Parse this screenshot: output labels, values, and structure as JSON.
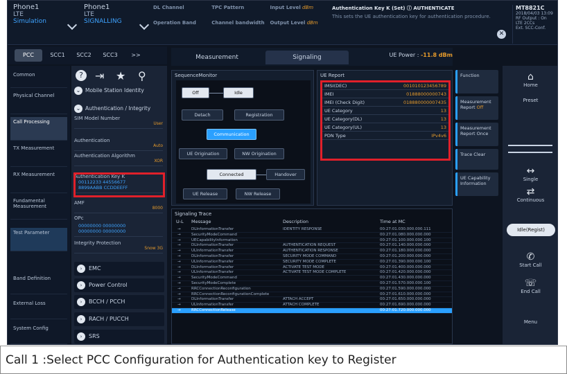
{
  "top": {
    "cell1": {
      "name": "Phone1",
      "line2": "LTE",
      "line3": "Simulation"
    },
    "cell2": {
      "name": "Phone1",
      "line2": "LTE",
      "line3": "SIGNALLING"
    },
    "stats": [
      {
        "label": "DL Channel",
        "value": ""
      },
      {
        "label": "TPC Pattern",
        "value": ""
      },
      {
        "label": "Input Level",
        "value": "dBm"
      },
      {
        "label": "Operation Band",
        "value": ""
      },
      {
        "label": "Channel bandwidth",
        "value": ""
      },
      {
        "label": "Output Level",
        "value": "dBm"
      }
    ],
    "auth_title": "Authentication Key K (Set) ⓘ AUTHENTICATE",
    "auth_desc": "This sets the UE authentication key for authentication procedure.",
    "sysinfo": {
      "logo": "MT8821C",
      "l1": "2018/04/03 13:09",
      "l2": "RF Output : On",
      "l3": "LTE 2CCs",
      "l4": "Ext. SCC-Conf."
    }
  },
  "cc_tabs": [
    "PCC",
    "SCC1",
    "SCC2",
    "SCC3",
    ">>"
  ],
  "left_nav": [
    "Common",
    "Physical Channel",
    "Call Processing",
    "TX Measurement",
    "RX Measurement",
    "Fundamental Measurement",
    "Test Parameter",
    "Band Definition",
    "External Loss",
    "System Config"
  ],
  "feature_list": {
    "sec_mobile": "Mobile Station Identity",
    "sec_auth": "Authentication / Integrity",
    "sim_model_label": "SIM Model Number",
    "sim_model_value": "User",
    "authentication_label": "Authentication",
    "authentication_value": "Auto",
    "auth_alg_label": "Authentication Algorithm",
    "auth_alg_value": "XOR",
    "auth_key_label": "Authentication Key K",
    "auth_key_line1": "00112233 44556677",
    "auth_key_line2": "8899AABB CCDDEEFF",
    "amf_label": "AMF",
    "amf_value": "8000",
    "opc_label": "OPc",
    "opc_line1": "00000000 00000000",
    "opc_line2": "00000000 00000000",
    "integrity_label": "Integrity Protection",
    "integrity_value": "Snow 3G",
    "sections": [
      "EMC",
      "Power Control",
      "BCCH / PCCH",
      "RACH / PUCCH",
      "SRS"
    ]
  },
  "tabs": {
    "measurement": "Measurement",
    "signaling": "Signaling"
  },
  "ue_power": {
    "label": "UE Power :",
    "value": "-11.8 dBm"
  },
  "sequence_monitor": {
    "title": "SequenceMonitor",
    "nodes": [
      "Off",
      "Idle",
      "Detach",
      "Registration",
      "Communication",
      "UE Origination",
      "NW Origination",
      "Connected",
      "Handover",
      "UE Release",
      "NW Release"
    ]
  },
  "ue_report": {
    "title": "UE Report",
    "rows": [
      {
        "key": "IMSI(DEC)",
        "value": "001010123456789"
      },
      {
        "key": "IMEI",
        "value": "01888000000743"
      },
      {
        "key": "IMEI (Check Digit)",
        "value": "018880000007435"
      },
      {
        "key": "UE Category",
        "value": "13"
      },
      {
        "key": "UE Category(DL)",
        "value": "13"
      },
      {
        "key": "UE Category(UL)",
        "value": "13"
      },
      {
        "key": "PDN Type",
        "value": "IPv4v6"
      }
    ]
  },
  "right_buttons": [
    {
      "label": "Function",
      "sub": ""
    },
    {
      "label": "Measurement Report",
      "sub": "Off"
    },
    {
      "label": "Measurement Report Once",
      "sub": ""
    },
    {
      "label": "Trace Clear",
      "sub": ""
    },
    {
      "label": "UE Capability Information",
      "sub": ""
    }
  ],
  "far_right": {
    "home": "Home",
    "preset": "Preset",
    "single": "Single",
    "continuous": "Continuous",
    "status_pill": "Idle(Regist)",
    "start_call": "Start Call",
    "end_call": "End Call",
    "menu": "Menu"
  },
  "trace": {
    "title": "Signaling Trace",
    "headers": [
      "U-L",
      "Message",
      "Description",
      "Time at MC"
    ],
    "rows": [
      {
        "dir": "→",
        "msg": "DLInformationTransfer",
        "desc": "IDENTITY RESPONSE",
        "time": "00:27:01.030.000.000.111"
      },
      {
        "dir": "→",
        "msg": "SecurityModeCommand",
        "desc": "",
        "time": "00:27:01.080.000.000.000"
      },
      {
        "dir": "→",
        "msg": "UECapabilityInformation",
        "desc": "",
        "time": "00:27:01.100.000.000.100"
      },
      {
        "dir": "→",
        "msg": "DLInformationTransfer",
        "desc": "AUTHENTICATION REQUEST",
        "time": "00:27:01.140.000.000.000"
      },
      {
        "dir": "→",
        "msg": "ULInformationTransfer",
        "desc": "AUTHENTICATION RESPONSE",
        "time": "00:27:01.180.000.000.000"
      },
      {
        "dir": "→",
        "msg": "DLInformationTransfer",
        "desc": "SECURITY MODE COMMAND",
        "time": "00:27:01.200.000.000.000"
      },
      {
        "dir": "→",
        "msg": "ULInformationTransfer",
        "desc": "SECURITY MODE COMPLETE",
        "time": "00:27:01.390.000.000.100"
      },
      {
        "dir": "→",
        "msg": "DLInformationTransfer",
        "desc": "ACTIVATE TEST MODE",
        "time": "00:27:01.400.000.000.000"
      },
      {
        "dir": "→",
        "msg": "ULInformationTransfer",
        "desc": "ACTIVATE TEST MODE COMPLETE",
        "time": "00:27:01.420.000.000.000"
      },
      {
        "dir": "→",
        "msg": "SecurityModeCommand",
        "desc": "",
        "time": "00:27:01.430.000.000.000"
      },
      {
        "dir": "→",
        "msg": "SecurityModeComplete",
        "desc": "",
        "time": "00:27:01.570.000.000.100"
      },
      {
        "dir": "→",
        "msg": "RRCConnectionReconfiguration",
        "desc": "",
        "time": "00:27:01.590.000.000.000"
      },
      {
        "dir": "→",
        "msg": "RRCConnectionReconfigurationComplete",
        "desc": "",
        "time": "00:27:01.610.000.000.000"
      },
      {
        "dir": "→",
        "msg": "DLInformationTransfer",
        "desc": "ATTACH ACCEPT",
        "time": "00:27:01.650.000.000.000"
      },
      {
        "dir": "→",
        "msg": "ULInformationTransfer",
        "desc": "ATTACH COMPLETE",
        "time": "00:27:01.690.000.000.000"
      },
      {
        "dir": "→",
        "msg": "RRCConnectionRelease",
        "desc": "",
        "time": "00:27:01.720.000.000.000"
      }
    ]
  },
  "caption": "Call 1 :Select PCC Configuration for Authentication key to Register"
}
